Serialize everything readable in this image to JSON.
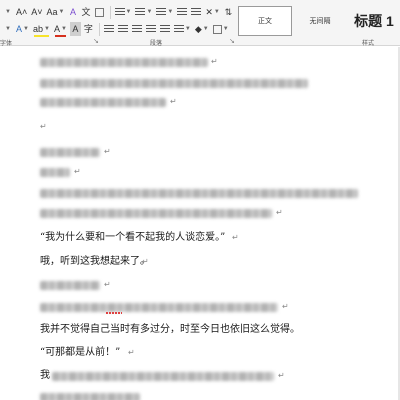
{
  "ribbon": {
    "row1": {
      "font_grow": "A˄",
      "font_shrink": "A˅",
      "change_case": "Aa",
      "clear_format": "A",
      "phonetic": "文"
    },
    "row2": {
      "text_effects": "A",
      "highlight": "ab",
      "font_color": "A",
      "char_shading": "A",
      "enclose_char": "字"
    },
    "labels": {
      "font_group": "字体",
      "paragraph_group": "段落",
      "styles_group": "样式"
    },
    "launcher_glyph": "↘",
    "styles": {
      "normal": "正文",
      "no_spacing": "无间隔",
      "heading1": "标题 1"
    }
  },
  "document": {
    "paragraph_mark": "↵",
    "visible_lines": [
      "“我为什么要和一个看不起我的人谈恋爱。”",
      "哦，听到这我想起来了。",
      "我并不觉得自己当时有多过分，时至今日也依旧这么觉得。",
      "“可那都是从前！”",
      "我"
    ]
  },
  "colors": {
    "font_color_bar": "#d6301d",
    "highlight_bar": "#f7e32a",
    "ribbon_bg": "#f5f5f5"
  }
}
